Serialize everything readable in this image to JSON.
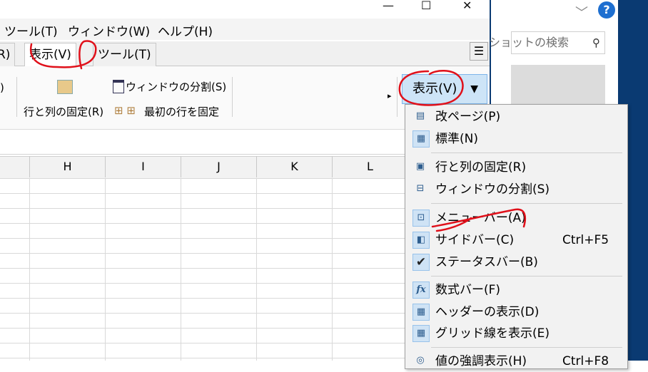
{
  "menubar": {
    "items": [
      "ツール(T)",
      "ウィンドウ(W)",
      "ヘルプ(H)"
    ]
  },
  "tabs": {
    "partial": "R)",
    "view": "表示(V)",
    "tools": "ツール(T)"
  },
  "ribbon": {
    "partial_left": ")",
    "freeze_rows_cols": "行と列の固定(R)",
    "split_window": "ウィンドウの分割(S)",
    "freeze_first_row": "最初の行を固定",
    "more_arrow": "▸"
  },
  "view_button": {
    "label": "表示(V)",
    "arrow": "▼"
  },
  "columns": [
    "H",
    "I",
    "J",
    "K",
    "L"
  ],
  "right_panel": {
    "search_placeholder": "ショットの検索",
    "help": "?"
  },
  "dropdown": {
    "items": [
      {
        "label": "改ページ(P)",
        "shortcut": "",
        "icon": "page-break-icon"
      },
      {
        "label": "標準(N)",
        "shortcut": "",
        "icon": "normal-view-icon"
      },
      {
        "label": "行と列の固定(R)",
        "shortcut": "",
        "icon": "freeze-rows-cols-icon"
      },
      {
        "label": "ウィンドウの分割(S)",
        "shortcut": "",
        "icon": "split-window-icon"
      },
      {
        "label": "メニューバー(A)",
        "shortcut": "",
        "icon": "menubar-icon"
      },
      {
        "label": "サイドバー(C)",
        "shortcut": "Ctrl+F5",
        "icon": "sidebar-icon"
      },
      {
        "label": "ステータスバー(B)",
        "shortcut": "",
        "icon": "checkmark-icon"
      },
      {
        "label": "数式バー(F)",
        "shortcut": "",
        "icon": "fx-icon"
      },
      {
        "label": "ヘッダーの表示(D)",
        "shortcut": "",
        "icon": "headers-icon"
      },
      {
        "label": "グリッド線を表示(E)",
        "shortcut": "",
        "icon": "gridlines-icon"
      },
      {
        "label": "値の強調表示(H)",
        "shortcut": "Ctrl+F8",
        "icon": "highlight-values-icon"
      }
    ]
  },
  "colors": {
    "accent": "#cde4f7",
    "annotation": "#e0101a",
    "desktop": "#0a3a72"
  }
}
